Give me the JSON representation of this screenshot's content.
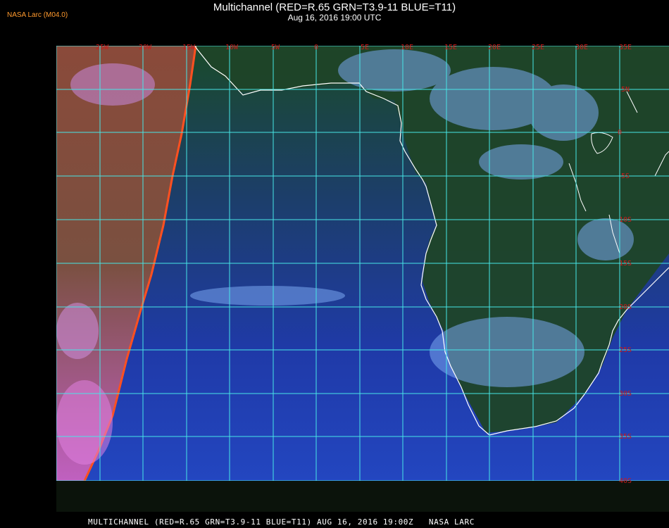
{
  "header": {
    "source_label": "NASA Larc (M04.0)",
    "title": "Multichannel (RED=R.65 GRN=T3.9-11 BLUE=T11)",
    "subtitle": "Aug 16, 2016 19:00 UTC"
  },
  "footer": {
    "text": "MULTICHANNEL (RED=R.65 GRN=T3.9-11 BLUE=T11) AUG 16, 2016 19:00Z   NASA LARC"
  },
  "map": {
    "lon_labels": [
      "25W",
      "20W",
      "15W",
      "10W",
      "5W",
      "0",
      "5E",
      "10E",
      "15E",
      "20E",
      "25E",
      "30E",
      "35E"
    ],
    "lat_labels": [
      "5N",
      "0",
      "5S",
      "10S",
      "15S",
      "20S",
      "25S",
      "30S",
      "35S",
      "40S"
    ],
    "colors": {
      "grid": "#47e6e6",
      "label": "#cc1a1a",
      "coast": "#ffffff",
      "ocean": "#1f3ca8",
      "land": "#1f4a2a",
      "scan_edge": "#ff5020"
    }
  }
}
